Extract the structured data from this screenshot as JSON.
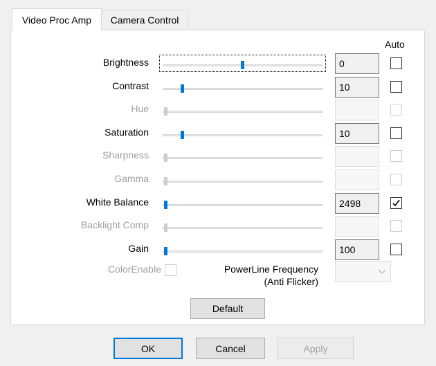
{
  "tabs": [
    {
      "label": "Video Proc Amp",
      "active": true
    },
    {
      "label": "Camera Control",
      "active": false
    }
  ],
  "auto_header": "Auto",
  "rows": [
    {
      "label": "Brightness",
      "value": "0",
      "enabled": true,
      "level": 0.5,
      "auto": false
    },
    {
      "label": "Contrast",
      "value": "10",
      "enabled": true,
      "level": 0.11,
      "auto": false
    },
    {
      "label": "Hue",
      "value": "",
      "enabled": false,
      "level": 0.0,
      "auto": false
    },
    {
      "label": "Saturation",
      "value": "10",
      "enabled": true,
      "level": 0.11,
      "auto": false
    },
    {
      "label": "Sharpness",
      "value": "",
      "enabled": false,
      "level": 0.0,
      "auto": false
    },
    {
      "label": "Gamma",
      "value": "",
      "enabled": false,
      "level": 0.0,
      "auto": false
    },
    {
      "label": "White Balance",
      "value": "2498",
      "enabled": true,
      "level": 0.0,
      "auto": true
    },
    {
      "label": "Backlight Comp",
      "value": "",
      "enabled": false,
      "level": 0.0,
      "auto": false
    },
    {
      "label": "Gain",
      "value": "100",
      "enabled": true,
      "level": 0.0,
      "auto": false
    }
  ],
  "color_enable": {
    "label": "ColorEnable",
    "checked": false,
    "enabled": false
  },
  "powerline": {
    "label_line1": "PowerLine Frequency",
    "label_line2": "(Anti Flicker)",
    "value": ""
  },
  "buttons": {
    "default": "Default",
    "ok": "OK",
    "cancel": "Cancel",
    "apply": "Apply"
  },
  "colors": {
    "accent": "#0078d7",
    "disabled_text": "#a0a0a0"
  }
}
